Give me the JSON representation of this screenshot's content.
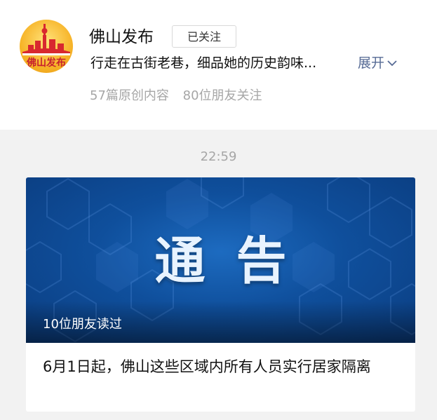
{
  "account": {
    "name": "佛山发布",
    "avatar_text": "佛山发布",
    "follow_label": "已关注",
    "description": "行走在古街老巷，细品她的历史韵味...",
    "expand_label": "展开",
    "original_count": "57篇原创内容",
    "friends_following": "80位朋友关注"
  },
  "feed": {
    "timestamp": "22:59",
    "article": {
      "cover_title": "通告",
      "friends_read": "10位朋友读过",
      "title": "6月1日起，佛山这些区域内所有人员实行居家隔离"
    }
  },
  "colors": {
    "link": "#576b95",
    "cover_blue": "#0f4f9c",
    "avatar_gold": "#f7b52a",
    "avatar_red": "#c7212f"
  }
}
